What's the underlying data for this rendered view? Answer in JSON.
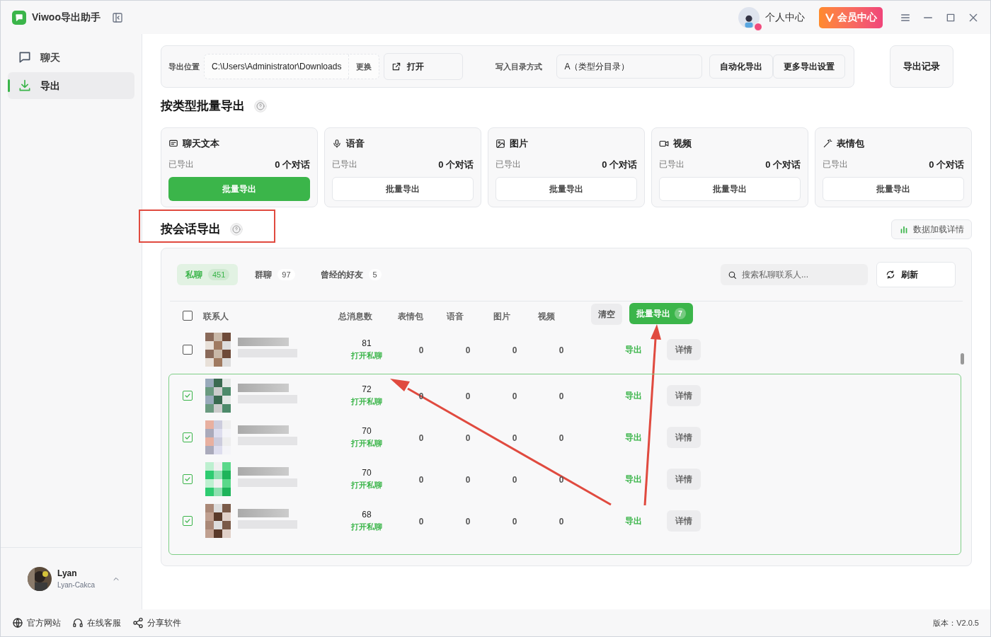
{
  "app": {
    "title": "Viwoo导出助手",
    "profile": "个人中心",
    "vip": "会员中心"
  },
  "sidebar": {
    "items": [
      {
        "label": "聊天",
        "selected": false
      },
      {
        "label": "导出",
        "selected": true
      }
    ],
    "user": {
      "name": "Lyan",
      "id": "Lyan-Cakca"
    }
  },
  "toolbar": {
    "location_label": "导出位置",
    "path": "C:\\Users\\Administrator\\Downloads",
    "change": "更换",
    "open": "打开",
    "dir_label": "写入目录方式",
    "dir_mode": "A（类型分目录）",
    "auto": "自动化导出",
    "more": "更多导出设置",
    "history": "导出记录"
  },
  "by_type": {
    "title": "按类型批量导出",
    "cards": [
      {
        "title": "聊天文本",
        "status": "已导出",
        "count": "0 个对话",
        "button": "批量导出",
        "selected": true
      },
      {
        "title": "语音",
        "status": "已导出",
        "count": "0 个对话",
        "button": "批量导出",
        "selected": false
      },
      {
        "title": "图片",
        "status": "已导出",
        "count": "0 个对话",
        "button": "批量导出",
        "selected": false
      },
      {
        "title": "视频",
        "status": "已导出",
        "count": "0 个对话",
        "button": "批量导出",
        "selected": false
      },
      {
        "title": "表情包",
        "status": "已导出",
        "count": "0 个对话",
        "button": "批量导出",
        "selected": false
      }
    ]
  },
  "by_session": {
    "title": "按会话导出",
    "load_details": "数据加载详情",
    "tabs": [
      {
        "label": "私聊",
        "count": "451",
        "selected": true
      },
      {
        "label": "群聊",
        "count": "97",
        "selected": false
      },
      {
        "label": "曾经的好友",
        "count": "5",
        "selected": false
      }
    ],
    "search": {
      "placeholder": "搜索私聊联系人..."
    },
    "refresh": "刷新",
    "columns": [
      "联系人",
      "总消息数",
      "表情包",
      "语音",
      "图片",
      "视频"
    ],
    "select_all_checked": false,
    "clear": "清空",
    "batch_export": "批量导出",
    "batch_count": "7",
    "rows": [
      {
        "checked": false,
        "messages": "81",
        "open": "打开私聊",
        "stats": [
          "0",
          "0",
          "0",
          "0"
        ],
        "export": "导出",
        "details": "详情"
      },
      {
        "checked": true,
        "messages": "72",
        "open": "打开私聊",
        "stats": [
          "0",
          "0",
          "0",
          "0"
        ],
        "export": "导出",
        "details": "详情"
      },
      {
        "checked": true,
        "messages": "70",
        "open": "打开私聊",
        "stats": [
          "0",
          "0",
          "0",
          "0"
        ],
        "export": "导出",
        "details": "详情"
      },
      {
        "checked": true,
        "messages": "70",
        "open": "打开私聊",
        "stats": [
          "0",
          "0",
          "0",
          "0"
        ],
        "export": "导出",
        "details": "详情"
      },
      {
        "checked": true,
        "messages": "68",
        "open": "打开私聊",
        "stats": [
          "0",
          "0",
          "0",
          "0"
        ],
        "export": "导出",
        "details": "详情"
      }
    ]
  },
  "footer": {
    "links": [
      {
        "label": "官方网站"
      },
      {
        "label": "在线客服"
      },
      {
        "label": "分享软件"
      }
    ],
    "version": "版本：V2.0.5"
  }
}
